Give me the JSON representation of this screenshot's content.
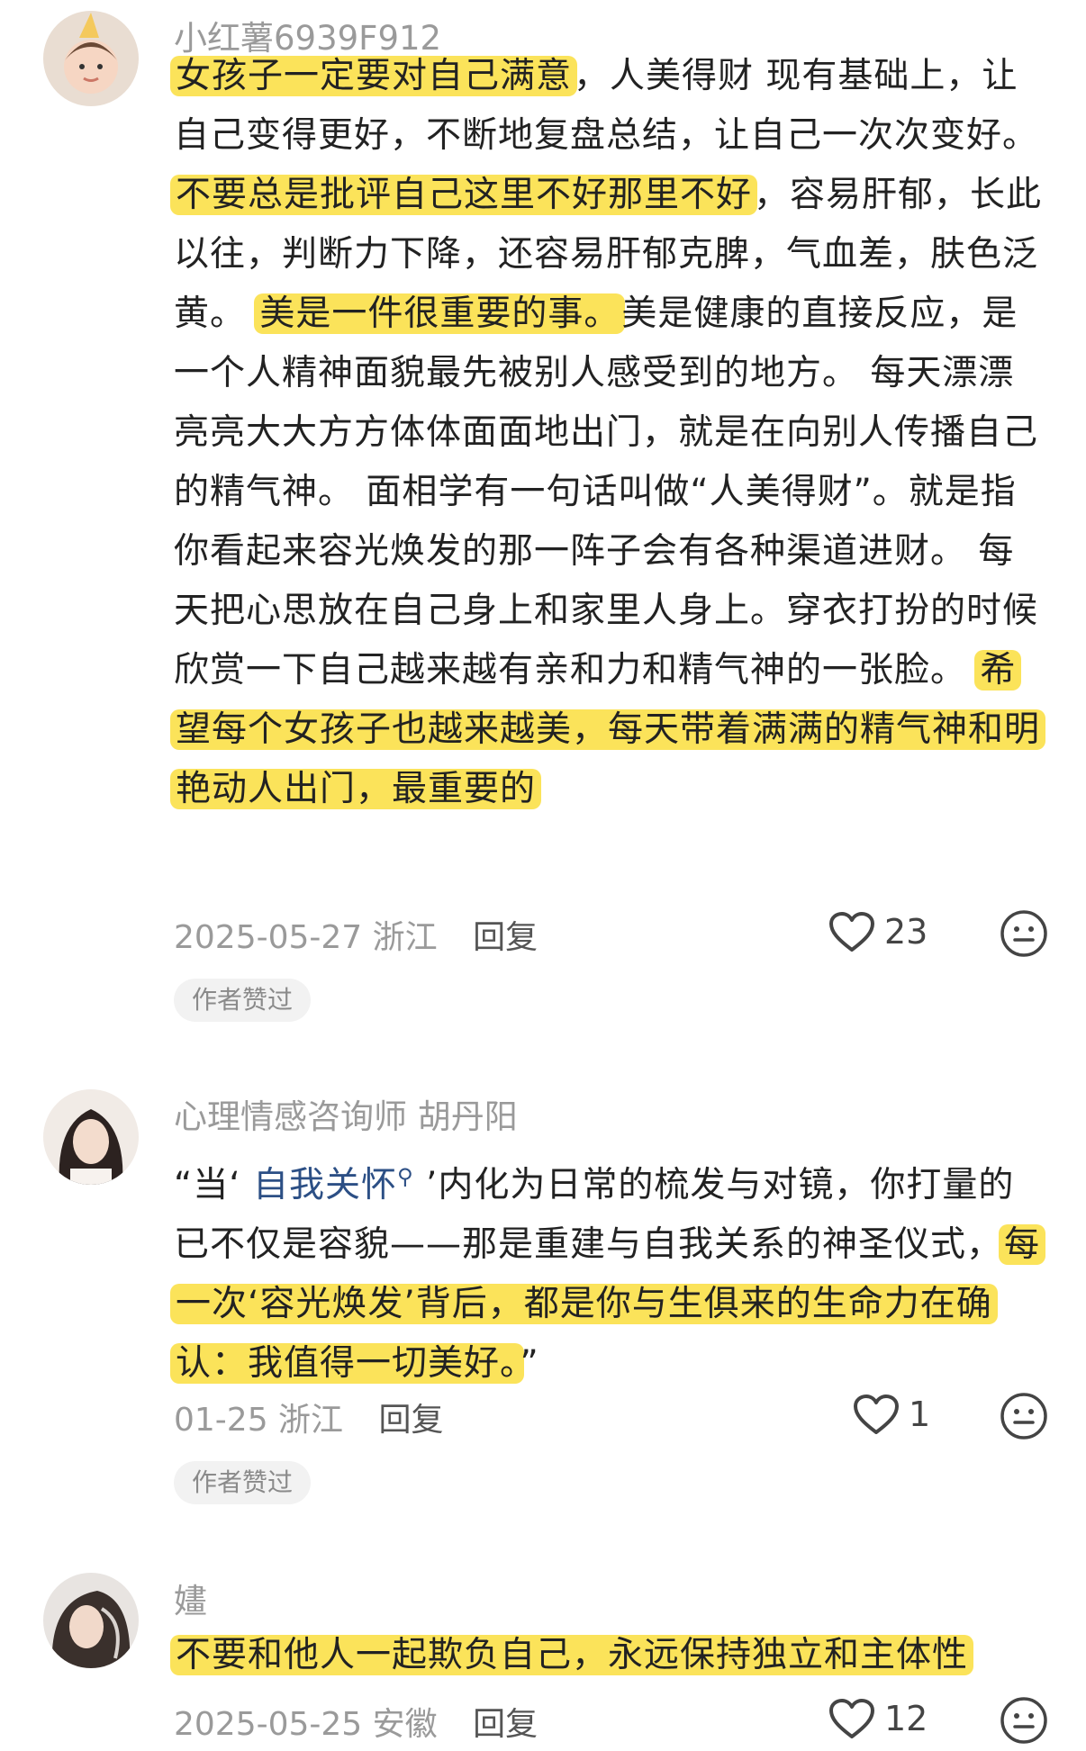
{
  "comments": [
    {
      "username": "小红薯6939F912",
      "body": [
        {
          "t": "女孩子一定要对自己满意",
          "h": true
        },
        {
          "t": "，人美得财 现有基础上，让自己变得更好，不断地复盘总结，让自己一次次变好。 ",
          "h": false
        },
        {
          "t": "不要总是批评自己这里不好那里不好",
          "h": true
        },
        {
          "t": "，容易肝郁，长此以往，判断力下降，还容易肝郁克脾，气血差，肤色泛黄。 ",
          "h": false
        },
        {
          "t": "美是一件很重要的事。",
          "h": true
        },
        {
          "t": "美是健康的直接反应，是一个人精神面貌最先被别人感受到的地方。 每天漂漂亮亮大大方方体体面面地出门，就是在向别人传播自己的精气神。 面相学有一句话叫做“人美得财”。就是指你看起来容光焕发的那一阵子会有各种渠道进财。 每天把心思放在自己身上和家里人身上。穿衣打扮的时候欣赏一下自己越来越有亲和力和精气神的一张脸。 ",
          "h": false
        },
        {
          "t": "希望每个女孩子也越来越美，每天带着满满的精气神和明艳动人出门，最重要的",
          "h": true
        }
      ],
      "date_location": "2025-05-27 浙江",
      "reply_label": "回复",
      "likes": "23",
      "badge": "作者赞过"
    },
    {
      "username": "心理情感咨询师 胡丹阳",
      "body": [
        {
          "t": "“当‘ ",
          "h": false
        },
        {
          "t": "自我关怀",
          "h": false,
          "link": true
        },
        {
          "t": " ’内化为日常的梳发与对镜，你打量的已不仅是容貌——那是重建与自我关系的神圣仪式，",
          "h": false
        },
        {
          "t": "每一次‘容光焕发’背后，都是你与生俱来的生命力在确认：我值得一切美好。",
          "h": true
        },
        {
          "t": "”",
          "h": false
        }
      ],
      "date_location": "01-25 浙江",
      "reply_label": "回复",
      "likes": "1",
      "badge": "作者赞过"
    },
    {
      "username": "嫿",
      "body": [
        {
          "t": "不要和他人一起欺负自己，永远保持独立和主体性",
          "h": true
        }
      ],
      "date_location": "2025-05-25 安徽",
      "reply_label": "回复",
      "likes": "12",
      "badge": ""
    }
  ],
  "colors": {
    "highlight": "#fbe35a",
    "link": "#2c4f85",
    "muted": "#9a9a9a"
  },
  "icons": {
    "like": "heart-outline-icon",
    "more": "neutral-face-icon",
    "search": "search-icon"
  }
}
